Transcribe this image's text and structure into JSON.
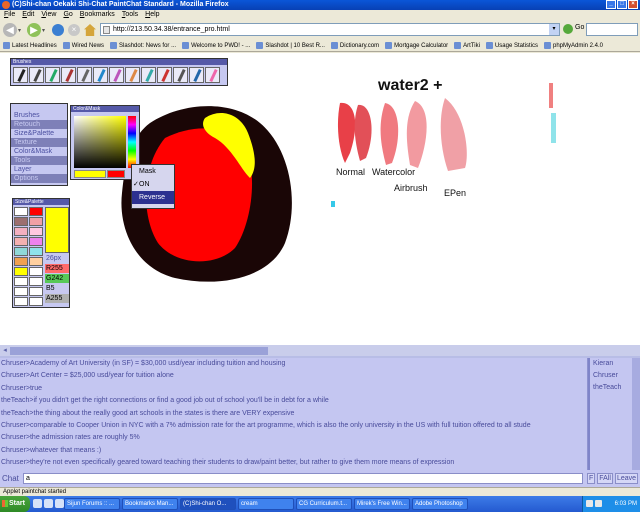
{
  "window": {
    "title": "(C)Shi-chan Oekaki Shi-Chat PaintChat Standard - Mozilla Firefox"
  },
  "menubar": [
    "File",
    "Edit",
    "View",
    "Go",
    "Bookmarks",
    "Tools",
    "Help"
  ],
  "navbar": {
    "url": "http://213.50.34.38/entrance_pro.html",
    "go_label": "Go"
  },
  "bookmarks": [
    "Latest Headlines",
    "Wired News",
    "Slashdot: News for ...",
    "Welcome to PWD! - ...",
    "Slashdot | 10 Best R...",
    "Dictionary.com",
    "Mortgage Calculator",
    "ArtTiki",
    "Usage Statistics",
    "phpMyAdmin 2.4.0"
  ],
  "panels": {
    "brushes_title": "Brushes",
    "colormask_title": "Color&Mask",
    "sizepalette_title": "Size&Palette",
    "menu": [
      "Brushes",
      "Retouch",
      "Size&Palette",
      "Texture",
      "Color&Mask",
      "Tools",
      "Layer",
      "Options"
    ],
    "size_value": "26px",
    "rgba": {
      "r": "R255",
      "g": "G242",
      "b": "B5",
      "a": "A255"
    }
  },
  "context_menu": {
    "items": [
      "Mask",
      "ON",
      "Reverse"
    ],
    "checked": "ON",
    "selected": "Reverse"
  },
  "canvas": {
    "heading": "water2 +",
    "labels": [
      "Normal",
      "Watercolor",
      "Airbrush",
      "EPen"
    ]
  },
  "chat": {
    "lines": [
      "Chruser>Academy of Art University (in SF) = $30,000 usd/year including tuition and housing",
      "Chruser>Art Center = $25,000 usd/year for tuition alone",
      "Chruser>true",
      "theTeach>if you didn't get the right connections or find a good job out of school you'll be in debt for a while",
      "theTeach>the thing about the really good art schools in the states is there are VERY expensive",
      "Chruser>comparable to Cooper Union in NYC with a 7% admission rate for the art programme, which is also the only university in the US with full tuition offered to all stude",
      "Chruser>the admission rates are roughly 5%",
      "Chruser>whatever that means :)",
      "Chruser>they're not even specifically geared toward teaching their students to draw/paint better, but rather to give them more means of expression"
    ],
    "users": [
      "Kieran",
      "Chruser",
      "theTeach"
    ],
    "input_label": "Chat",
    "input_value": "a",
    "buttons": [
      "F",
      "FAll",
      "Leave"
    ]
  },
  "statusbar": "Applet paintchat started",
  "taskbar": {
    "start": "Start",
    "tasks": [
      "Sijun Forums :: ...",
      "Bookmarks Man...",
      "(C)Shi-chan O...",
      "cream",
      "CG Curriculum.t...",
      "Mirek's Free Win...",
      "Adobe Photoshop"
    ],
    "clock": "6:03 PM"
  },
  "colors": {
    "applet_bg": "#c6c8f1",
    "chat_text": "#484b9a",
    "accent_red": "#ff0000",
    "accent_yellow": "#ffff00"
  }
}
